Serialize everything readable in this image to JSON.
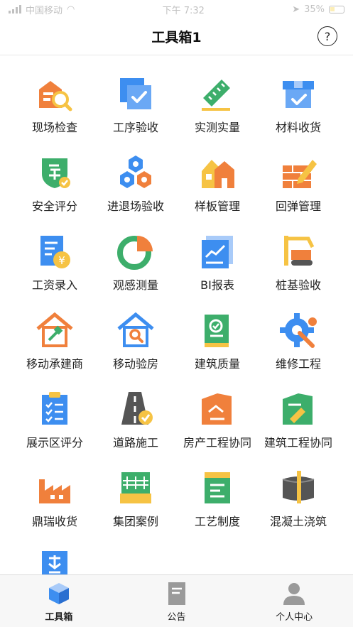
{
  "status": {
    "carrier": "中国移动",
    "time": "下午 7:32",
    "battery": "35%"
  },
  "header": {
    "title": "工具箱1",
    "help_label": "?"
  },
  "tools": [
    {
      "label": "现场检查",
      "icon": "site-inspection-icon"
    },
    {
      "label": "工序验收",
      "icon": "process-acceptance-icon"
    },
    {
      "label": "实测实量",
      "icon": "ruler-measure-icon"
    },
    {
      "label": "材料收货",
      "icon": "material-receipt-icon"
    },
    {
      "label": "安全评分",
      "icon": "safety-score-shield-icon"
    },
    {
      "label": "进退场验收",
      "icon": "hexagons-icon"
    },
    {
      "label": "样板管理",
      "icon": "sample-house-icon"
    },
    {
      "label": "回弹管理",
      "icon": "brick-pencil-icon"
    },
    {
      "label": "工资录入",
      "icon": "salary-doc-icon"
    },
    {
      "label": "观感测量",
      "icon": "pie-chart-icon"
    },
    {
      "label": "BI报表",
      "icon": "bi-report-icon"
    },
    {
      "label": "桩基验收",
      "icon": "pile-driver-icon"
    },
    {
      "label": "移动承建商",
      "icon": "contractor-house-icon"
    },
    {
      "label": "移动验房",
      "icon": "house-search-icon"
    },
    {
      "label": "建筑质量",
      "icon": "quality-book-icon"
    },
    {
      "label": "维修工程",
      "icon": "gear-wrench-icon"
    },
    {
      "label": "展示区评分",
      "icon": "clipboard-check-icon"
    },
    {
      "label": "道路施工",
      "icon": "road-icon"
    },
    {
      "label": "房产工程协同",
      "icon": "property-folder-icon"
    },
    {
      "label": "建筑工程协同",
      "icon": "building-folder-icon"
    },
    {
      "label": "鼎瑞收货",
      "icon": "factory-icon"
    },
    {
      "label": "集团案例",
      "icon": "group-case-icon"
    },
    {
      "label": "工艺制度",
      "icon": "craft-book-icon"
    },
    {
      "label": "混凝土浇筑",
      "icon": "concrete-pour-icon"
    },
    {
      "label": "",
      "icon": "misc-doc-icon"
    }
  ],
  "tabs": [
    {
      "label": "工具箱",
      "icon": "cube-icon",
      "active": true
    },
    {
      "label": "公告",
      "icon": "notice-doc-icon",
      "active": false
    },
    {
      "label": "个人中心",
      "icon": "person-icon",
      "active": false
    }
  ],
  "colors": {
    "orange": "#f0803c",
    "blue": "#3d8ef0",
    "green": "#3dae6b",
    "yellow": "#f6c344",
    "dark": "#555555"
  }
}
